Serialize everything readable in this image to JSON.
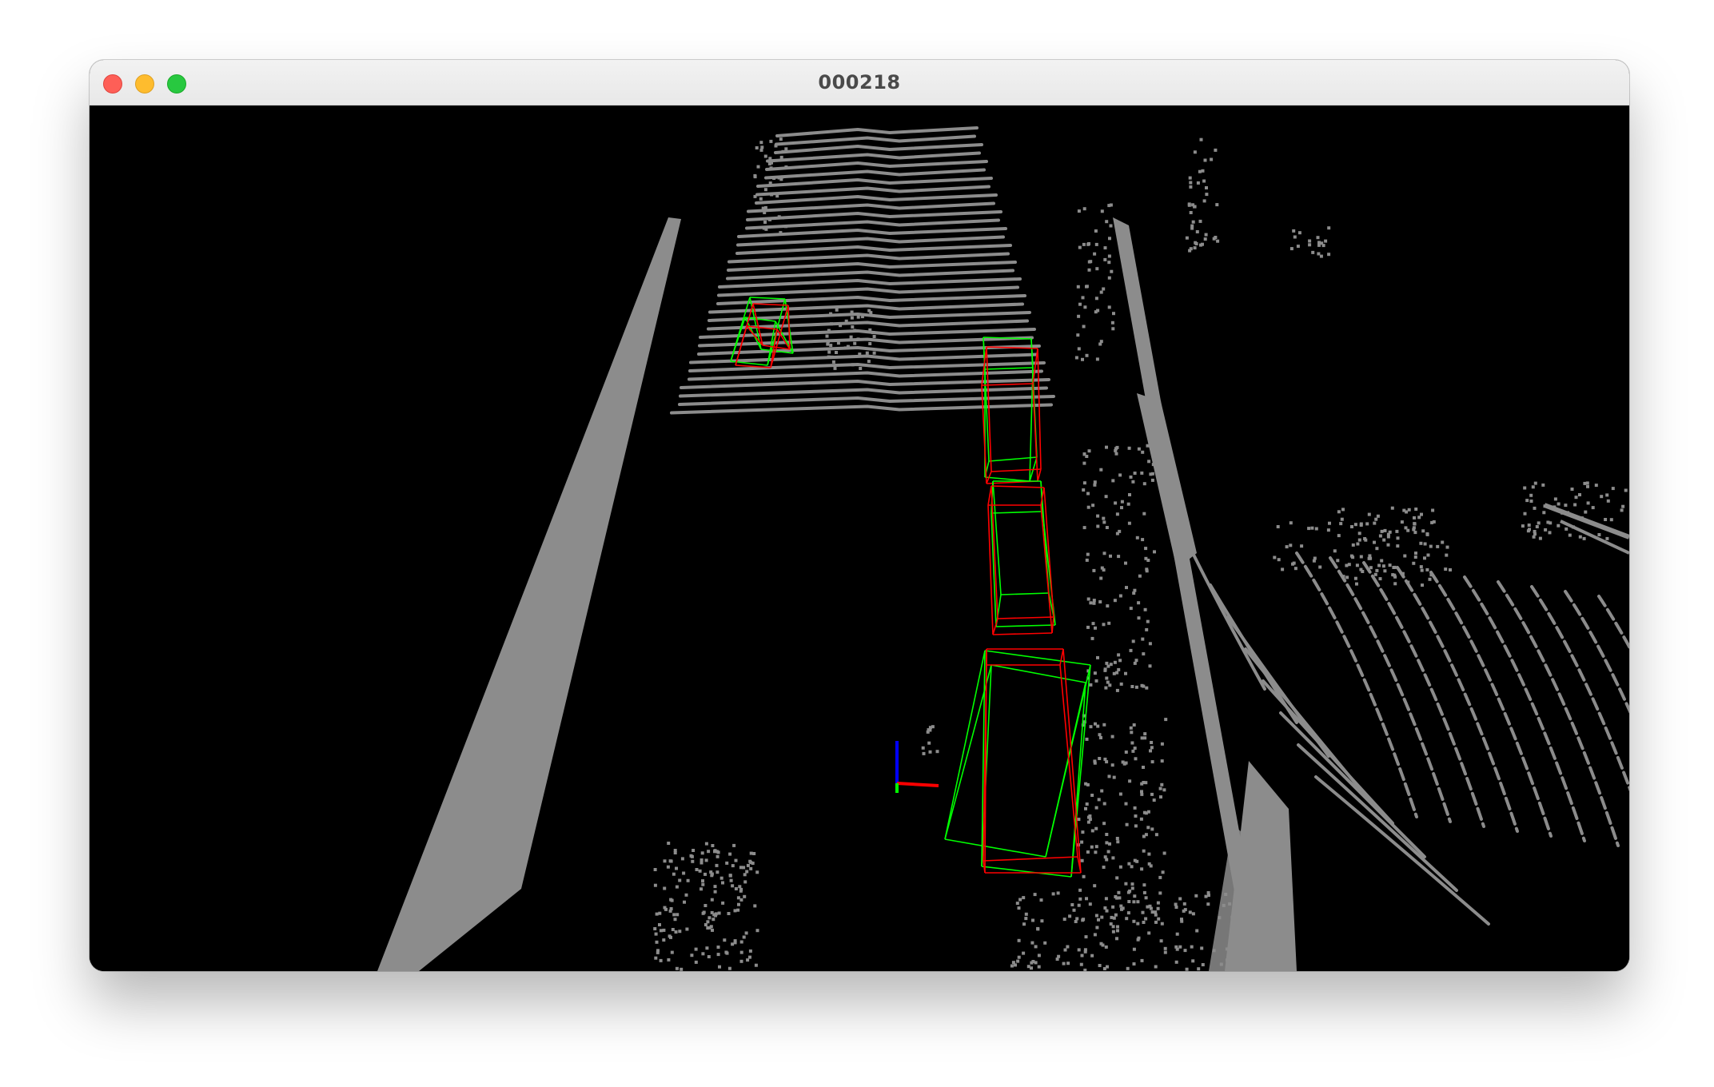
{
  "window": {
    "title": "000218"
  },
  "controls": {
    "close_icon": "close-icon",
    "minimize_icon": "minimize-icon",
    "zoom_icon": "zoom-icon"
  },
  "viewer": {
    "background_color": "#000000",
    "point_color": "#8c8c8c",
    "ground_truth_box_color": "#ff0000",
    "prediction_box_color": "#00ff00",
    "axis_colors": {
      "x": "#ff0000",
      "y": "#00ff00",
      "z": "#0000ff"
    },
    "detection_count": 4
  }
}
